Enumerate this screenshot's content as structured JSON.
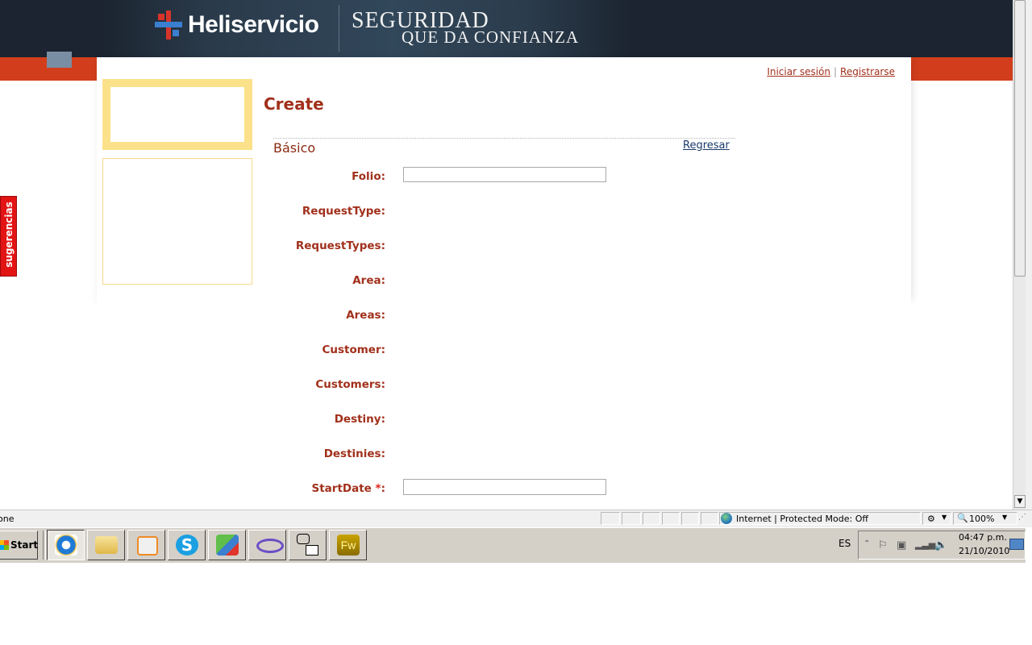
{
  "banner": {
    "logo_text": "Heliservicio",
    "slogan_line1": "SEGURIDAD",
    "slogan_line2": "QUE DA CONFIANZA"
  },
  "login": {
    "sign_in": "Iniciar sesión",
    "separator": "|",
    "register": "Registrarse"
  },
  "page": {
    "title": "Create",
    "section_title": "Básico",
    "back_link": "Regresar"
  },
  "form": {
    "fields": [
      {
        "label": "Folio:",
        "type": "text",
        "value": ""
      },
      {
        "label": "RequestType:"
      },
      {
        "label": "RequestTypes:"
      },
      {
        "label": "Area:"
      },
      {
        "label": "Areas:"
      },
      {
        "label": "Customer:"
      },
      {
        "label": "Customers:"
      },
      {
        "label": "Destiny:"
      },
      {
        "label": "Destinies:"
      },
      {
        "label": "StartDate",
        "required_mark": "*",
        "suffix": ":",
        "type": "text",
        "value": ""
      }
    ]
  },
  "suggestions_tab": "sugerencias",
  "statusbar": {
    "status_text": "one",
    "zone": "Internet | Protected Mode: Off",
    "zoom": "100%"
  },
  "taskbar": {
    "start_label": "Start",
    "apps": [
      {
        "icon": "internet-explorer-icon",
        "active": true
      },
      {
        "icon": "folder-icon"
      },
      {
        "icon": "media-player-icon"
      },
      {
        "icon": "skype-icon"
      },
      {
        "icon": "messenger-icon"
      },
      {
        "icon": "visual-studio-icon"
      },
      {
        "icon": "remote-desktop-icon"
      },
      {
        "icon": "fireworks-icon",
        "label": "Fw"
      }
    ],
    "language": "ES",
    "clock_time": "04:47 p.m.",
    "clock_date": "21/10/2010"
  },
  "colors": {
    "brand_red": "#a1301b",
    "orange_band": "#d23e1c",
    "dark_band": "#1b2430",
    "side_yellow": "#fbe18a",
    "suggest_red": "#e21414"
  }
}
